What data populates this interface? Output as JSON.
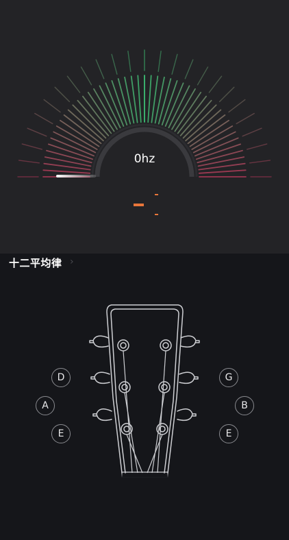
{
  "tuner": {
    "frequency": "0hz",
    "accent_green": "#3fd07c",
    "accent_red": "#c23a5e",
    "accent_orange": "#e8763a"
  },
  "temperament": {
    "label": "十二平均律",
    "chevron_icon": "chevron-right-icon"
  },
  "strings": {
    "left": [
      "D",
      "A",
      "E"
    ],
    "right": [
      "G",
      "B",
      "E"
    ]
  }
}
